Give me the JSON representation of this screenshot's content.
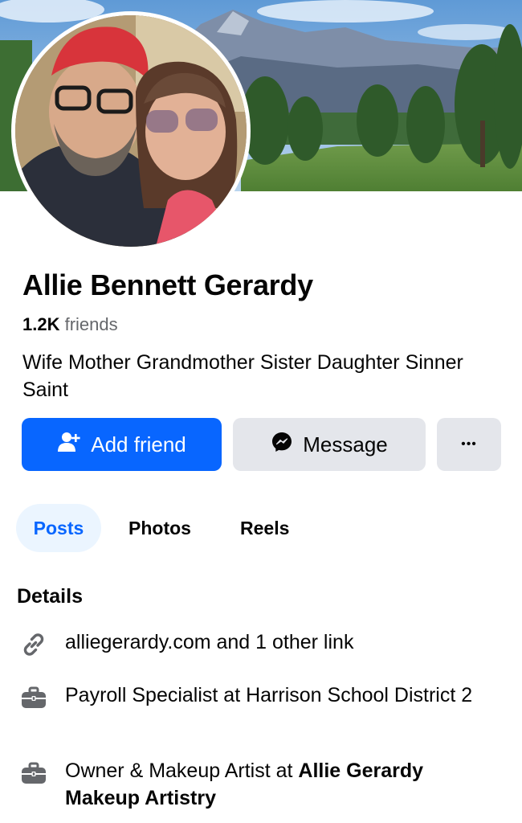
{
  "profile": {
    "name": "Allie Bennett Gerardy",
    "friends_count": "1.2K",
    "friends_label": " friends",
    "bio": "Wife Mother Grandmother Sister Daughter Sinner Saint"
  },
  "actions": {
    "add_friend": "Add friend",
    "message": "Message",
    "more": "•••"
  },
  "tabs": [
    {
      "label": "Posts",
      "active": true
    },
    {
      "label": "Photos",
      "active": false
    },
    {
      "label": "Reels",
      "active": false
    }
  ],
  "details": {
    "title": "Details",
    "items": [
      {
        "icon": "link-icon",
        "text": "alliegerardy.com and 1 other link"
      },
      {
        "icon": "briefcase-icon",
        "text": "Payroll Specialist at Harrison School District 2"
      },
      {
        "icon": "briefcase-icon",
        "prefix": "Owner & Makeup Artist at ",
        "bold": "Allie Gerardy Makeup Artistry"
      }
    ]
  },
  "colors": {
    "primary": "#0866ff",
    "secondary_button": "#e4e6eb",
    "active_tab_bg": "#ebf5ff",
    "muted_text": "#65676b"
  }
}
